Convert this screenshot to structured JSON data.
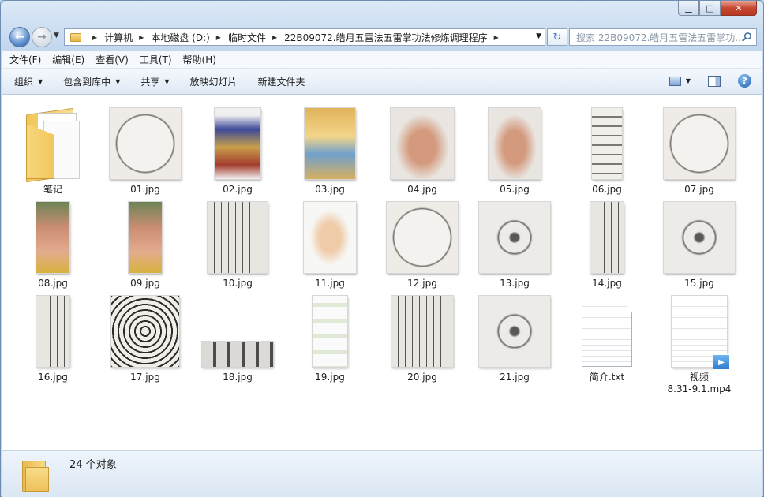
{
  "window": {
    "minimize": "▁",
    "maximize": "□",
    "close": "✕"
  },
  "address": {
    "crumbs": [
      "计算机",
      "本地磁盘 (D:)",
      "临时文件",
      "22B09072.皓月五雷法五雷掌功法修炼调理程序"
    ],
    "search_placeholder": "搜索 22B09072.皓月五雷法五雷掌功..."
  },
  "menu": [
    "文件(F)",
    "编辑(E)",
    "查看(V)",
    "工具(T)",
    "帮助(H)"
  ],
  "commands": {
    "organize": "组织",
    "include": "包含到库中",
    "share": "共享",
    "slideshow": "放映幻灯片",
    "new_folder": "新建文件夹"
  },
  "files": [
    {
      "name": "笔记",
      "kind": "folder"
    },
    {
      "name": "01.jpg",
      "kind": "image",
      "subject": "thunder-charm"
    },
    {
      "name": "02.jpg",
      "kind": "image",
      "subject": "deity-statue"
    },
    {
      "name": "03.jpg",
      "kind": "image",
      "subject": "deity-painting"
    },
    {
      "name": "04.jpg",
      "kind": "image",
      "subject": "hand-gesture"
    },
    {
      "name": "05.jpg",
      "kind": "image",
      "subject": "hand-gesture"
    },
    {
      "name": "06.jpg",
      "kind": "image",
      "subject": "talisman"
    },
    {
      "name": "07.jpg",
      "kind": "image",
      "subject": "thunder-charm"
    },
    {
      "name": "08.jpg",
      "kind": "image",
      "subject": "fist"
    },
    {
      "name": "09.jpg",
      "kind": "image",
      "subject": "fist"
    },
    {
      "name": "10.jpg",
      "kind": "image",
      "subject": "handwriting"
    },
    {
      "name": "11.jpg",
      "kind": "image",
      "subject": "praying-hands"
    },
    {
      "name": "12.jpg",
      "kind": "image",
      "subject": "thunder-charm"
    },
    {
      "name": "13.jpg",
      "kind": "image",
      "subject": "charm-diagram"
    },
    {
      "name": "14.jpg",
      "kind": "image",
      "subject": "handwriting"
    },
    {
      "name": "15.jpg",
      "kind": "image",
      "subject": "charm-diagram"
    },
    {
      "name": "16.jpg",
      "kind": "image",
      "subject": "handwriting"
    },
    {
      "name": "17.jpg",
      "kind": "image",
      "subject": "spiral-talisman"
    },
    {
      "name": "18.jpg",
      "kind": "image",
      "subject": "charm-strip"
    },
    {
      "name": "19.jpg",
      "kind": "image",
      "subject": "chat-screenshot"
    },
    {
      "name": "20.jpg",
      "kind": "image",
      "subject": "handwriting"
    },
    {
      "name": "21.jpg",
      "kind": "image",
      "subject": "charm-diagram"
    },
    {
      "name": "简介.txt",
      "kind": "text"
    },
    {
      "name": "视频\n8.31-9.1.mp4",
      "kind": "video"
    }
  ],
  "status": {
    "count": "24 个对象"
  }
}
